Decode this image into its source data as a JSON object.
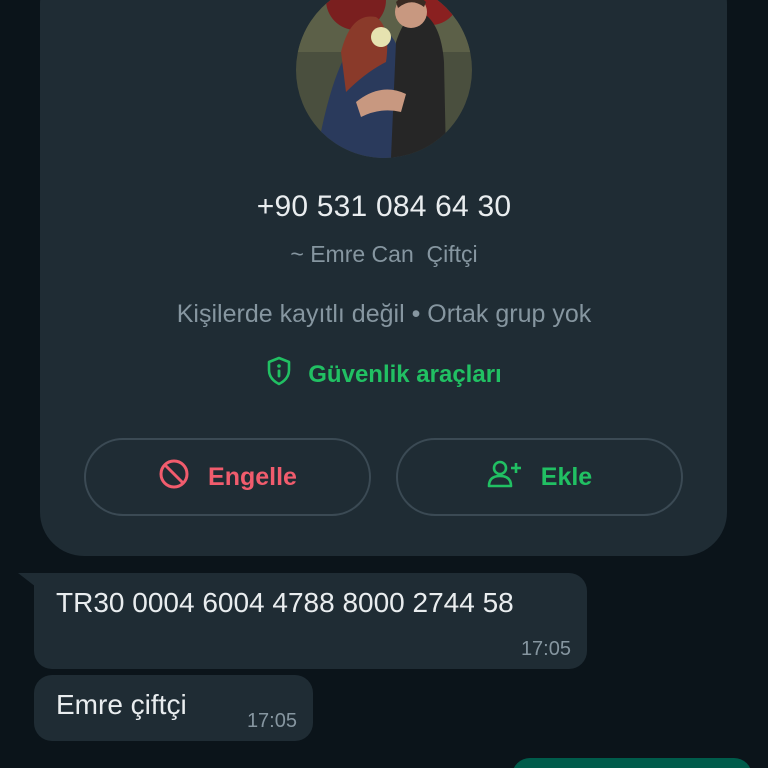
{
  "contact_card": {
    "phone_number": "+90 531 084 64 30",
    "push_name": "~ Emre Can  Çiftçi",
    "info": "Kişilerde kayıtlı değil • Ortak grup yok",
    "safety_tools_label": "Güvenlik araçları",
    "block_label": "Engelle",
    "add_label": "Ekle"
  },
  "messages": [
    {
      "text": "TR30 0004 6004 4788 8000 2744 58",
      "time": "17:05"
    },
    {
      "text": "Emre çiftçi",
      "time": "17:05"
    }
  ],
  "colors": {
    "background": "#0b141a",
    "card": "#1f2c34",
    "accent_green": "#21c063",
    "danger_red": "#f15c6d",
    "secondary_text": "#8696a0",
    "outgoing_bubble": "#005c4b"
  },
  "icons": [
    "shield-info-icon",
    "block-icon",
    "add-contact-icon"
  ]
}
